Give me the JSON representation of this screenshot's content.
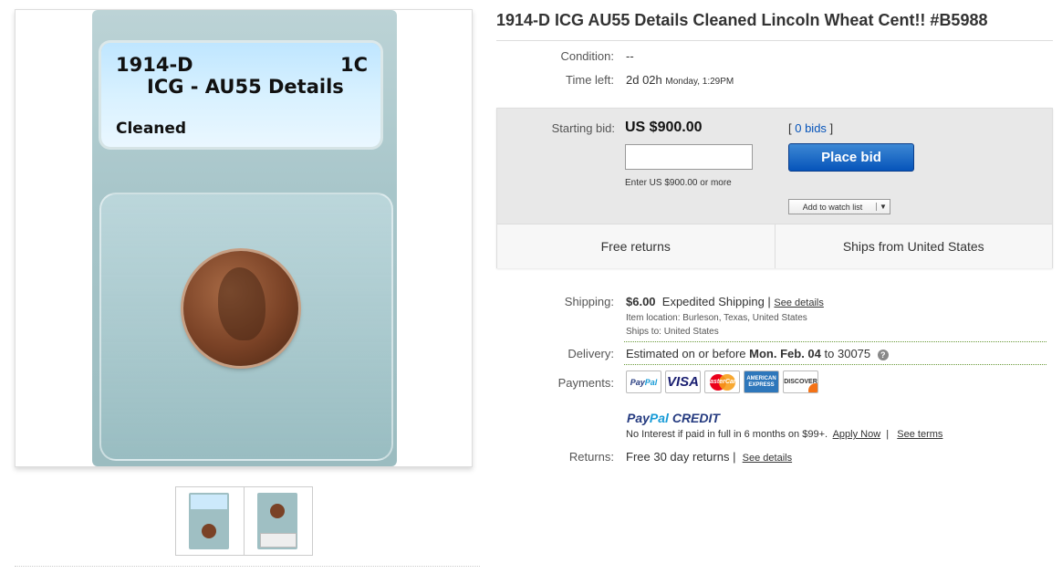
{
  "listing": {
    "title": "1914-D ICG AU55 Details Cleaned Lincoln Wheat Cent!! #B5988"
  },
  "image": {
    "label_line1": "1914-D",
    "label_denom": "1C",
    "label_line2": "ICG - AU55 Details",
    "label_line3": "Cleaned"
  },
  "details": {
    "condition_label": "Condition:",
    "condition_value": "--",
    "time_left_label": "Time left:",
    "time_left_value": "2d 02h",
    "time_left_end": "Monday, 1:29PM"
  },
  "bid": {
    "starting_label": "Starting bid:",
    "price": "US $900.00",
    "bid_count": "0 bids",
    "input_value": "",
    "hint": "Enter US $900.00 or more",
    "place_bid_label": "Place bid",
    "watch_label": "Add to watch list",
    "features": [
      "Free returns",
      "Ships from United States"
    ]
  },
  "shipping": {
    "label": "Shipping:",
    "price": "$6.00",
    "method": "Expedited Shipping",
    "see_details": "See details",
    "item_location": "Item location:  Burleson, Texas, United States",
    "ships_to": "Ships to:  United States"
  },
  "delivery": {
    "label": "Delivery:",
    "prefix": "Estimated on or before",
    "date": "Mon. Feb. 04",
    "to": "to",
    "zip": "30075"
  },
  "payments": {
    "label": "Payments:",
    "methods": [
      "PayPal",
      "VISA",
      "MasterCard",
      "American Express",
      "Discover"
    ],
    "paypal_credit_1": "PayPal",
    "paypal_credit_2": "CREDIT",
    "credit_text": "No Interest if paid in full in 6 months on $99+.",
    "apply_now": "Apply Now",
    "see_terms": "See terms"
  },
  "returns": {
    "label": "Returns:",
    "value": "Free 30 day returns",
    "see_details": "See details"
  },
  "colors": {
    "accent_blue": "#0654ba",
    "link_blue": "#0654ba",
    "dotted_green": "#6a9a3a"
  }
}
